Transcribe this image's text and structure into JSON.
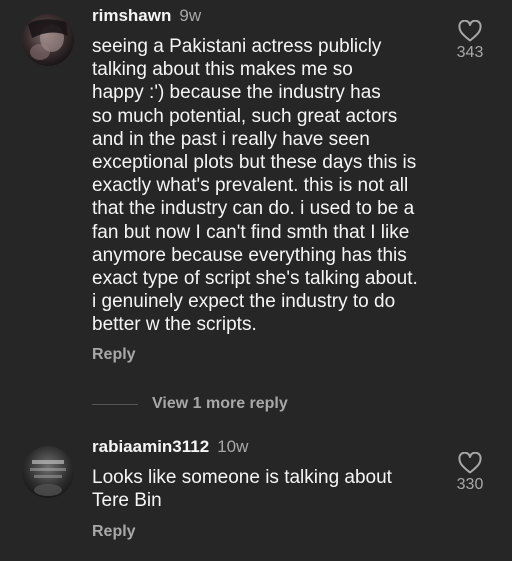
{
  "comments": [
    {
      "username": "rimshawn",
      "time": "9w",
      "text": "seeing a Pakistani actress publicly\ntalking about this makes me so\nhappy :') because the industry has\nso much potential, such great actors\nand in the past i really have seen\nexceptional plots but these days this is\nexactly what's prevalent. this is not all\nthat the industry can do. i used to be a\nfan but now I can't find smth that I like\nanymore because everything has this\nexact type of script she's talking about.\ni genuinely expect the industry to do\nbetter w the scripts.",
      "likes": "343",
      "reply_label": "Reply",
      "like_icon": "heart-outline-icon"
    },
    {
      "username": "rabiaamin3112",
      "time": "10w",
      "text": "Looks like someone is talking about\nTere Bin",
      "likes": "330",
      "reply_label": "Reply",
      "like_icon": "heart-outline-icon"
    }
  ],
  "view_more_label": "View 1 more reply",
  "colors": {
    "background": "#262626",
    "primary_text": "#f5f5f5",
    "secondary_text": "#a8a8a8"
  }
}
